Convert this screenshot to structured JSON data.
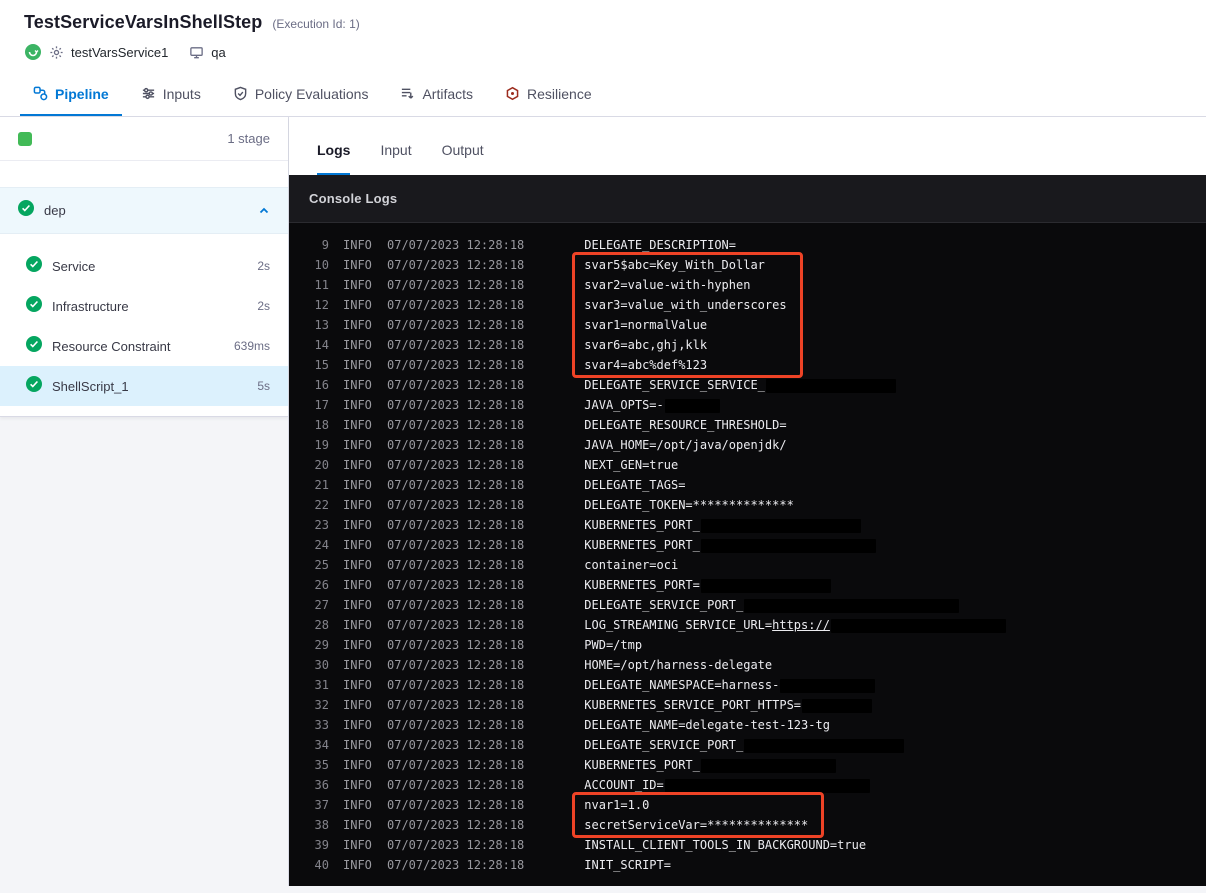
{
  "colors": {
    "accent": "#0278d5",
    "success": "#05a660",
    "highlight": "#ee4326",
    "console_background": "#0a0a0c"
  },
  "header": {
    "title": "TestServiceVarsInShellStep",
    "execution_id": "(Execution Id: 1)",
    "service_name": "testVarsService1",
    "environment": "qa"
  },
  "main_tabs": [
    {
      "label": "Pipeline",
      "icon": "pipeline-icon",
      "active": true
    },
    {
      "label": "Inputs",
      "icon": "inputs-icon",
      "active": false
    },
    {
      "label": "Policy Evaluations",
      "icon": "policy-evaluations-icon",
      "active": false
    },
    {
      "label": "Artifacts",
      "icon": "artifacts-icon",
      "active": false
    },
    {
      "label": "Resilience",
      "icon": "resilience-icon",
      "active": false
    }
  ],
  "sidebar": {
    "stage_count": "1 stage",
    "stage_name": "dep",
    "steps": [
      {
        "label": "Service",
        "duration": "2s",
        "selected": false
      },
      {
        "label": "Infrastructure",
        "duration": "2s",
        "selected": false
      },
      {
        "label": "Resource Constraint",
        "duration": "639ms",
        "selected": false
      },
      {
        "label": "ShellScript_1",
        "duration": "5s",
        "selected": true
      }
    ]
  },
  "log_panel": {
    "tabs": [
      {
        "label": "Logs",
        "active": true
      },
      {
        "label": "Input",
        "active": false
      },
      {
        "label": "Output",
        "active": false
      }
    ],
    "console_title": "Console Logs",
    "level": "INFO",
    "timestamp": "07/07/2023 12:28:18",
    "lines": [
      {
        "n": 9,
        "msg": "DELEGATE_DESCRIPTION="
      },
      {
        "n": 10,
        "msg": "svar5$abc=Key_With_Dollar"
      },
      {
        "n": 11,
        "msg": "svar2=value-with-hyphen"
      },
      {
        "n": 12,
        "msg": "svar3=value_with_underscores"
      },
      {
        "n": 13,
        "msg": "svar1=normalValue"
      },
      {
        "n": 14,
        "msg": "svar6=abc,ghj,klk"
      },
      {
        "n": 15,
        "msg": "svar4=abc%def%123"
      },
      {
        "n": 16,
        "msg": "DELEGATE_SERVICE_SERVICE_",
        "redact": 130
      },
      {
        "n": 17,
        "msg": "JAVA_OPTS=-",
        "redact": 55
      },
      {
        "n": 18,
        "msg": "DELEGATE_RESOURCE_THRESHOLD="
      },
      {
        "n": 19,
        "msg": "JAVA_HOME=/opt/java/openjdk/"
      },
      {
        "n": 20,
        "msg": "NEXT_GEN=true"
      },
      {
        "n": 21,
        "msg": "DELEGATE_TAGS="
      },
      {
        "n": 22,
        "msg": "DELEGATE_TOKEN=**************"
      },
      {
        "n": 23,
        "msg": "KUBERNETES_PORT_",
        "redact": 160
      },
      {
        "n": 24,
        "msg": "KUBERNETES_PORT_",
        "redact": 175
      },
      {
        "n": 25,
        "msg": "container=oci"
      },
      {
        "n": 26,
        "msg": "KUBERNETES_PORT=",
        "redact": 130
      },
      {
        "n": 27,
        "msg": "DELEGATE_SERVICE_PORT_",
        "redact": 215
      },
      {
        "n": 28,
        "msg": "LOG_STREAMING_SERVICE_URL=",
        "link": "https://",
        "redact": 175
      },
      {
        "n": 29,
        "msg": "PWD=/tmp"
      },
      {
        "n": 30,
        "msg": "HOME=/opt/harness-delegate"
      },
      {
        "n": 31,
        "msg": "DELEGATE_NAMESPACE=harness-",
        "redact": 95
      },
      {
        "n": 32,
        "msg": "KUBERNETES_SERVICE_PORT_HTTPS=",
        "redact": 70
      },
      {
        "n": 33,
        "msg": "DELEGATE_NAME=delegate-test-123-tg"
      },
      {
        "n": 34,
        "msg": "DELEGATE_SERVICE_PORT_",
        "redact": 160
      },
      {
        "n": 35,
        "msg": "KUBERNETES_PORT_",
        "redact": 135
      },
      {
        "n": 36,
        "msg": "ACCOUNT_ID=",
        "redact": 205
      },
      {
        "n": 37,
        "msg": "nvar1=1.0"
      },
      {
        "n": 38,
        "msg": "secretServiceVar=**************"
      },
      {
        "n": 39,
        "msg": "INSTALL_CLIENT_TOOLS_IN_BACKGROUND=true"
      },
      {
        "n": 40,
        "msg": "INIT_SCRIPT="
      }
    ],
    "highlight_groups": [
      {
        "from": 10,
        "to": 15
      },
      {
        "from": 37,
        "to": 38
      }
    ]
  }
}
